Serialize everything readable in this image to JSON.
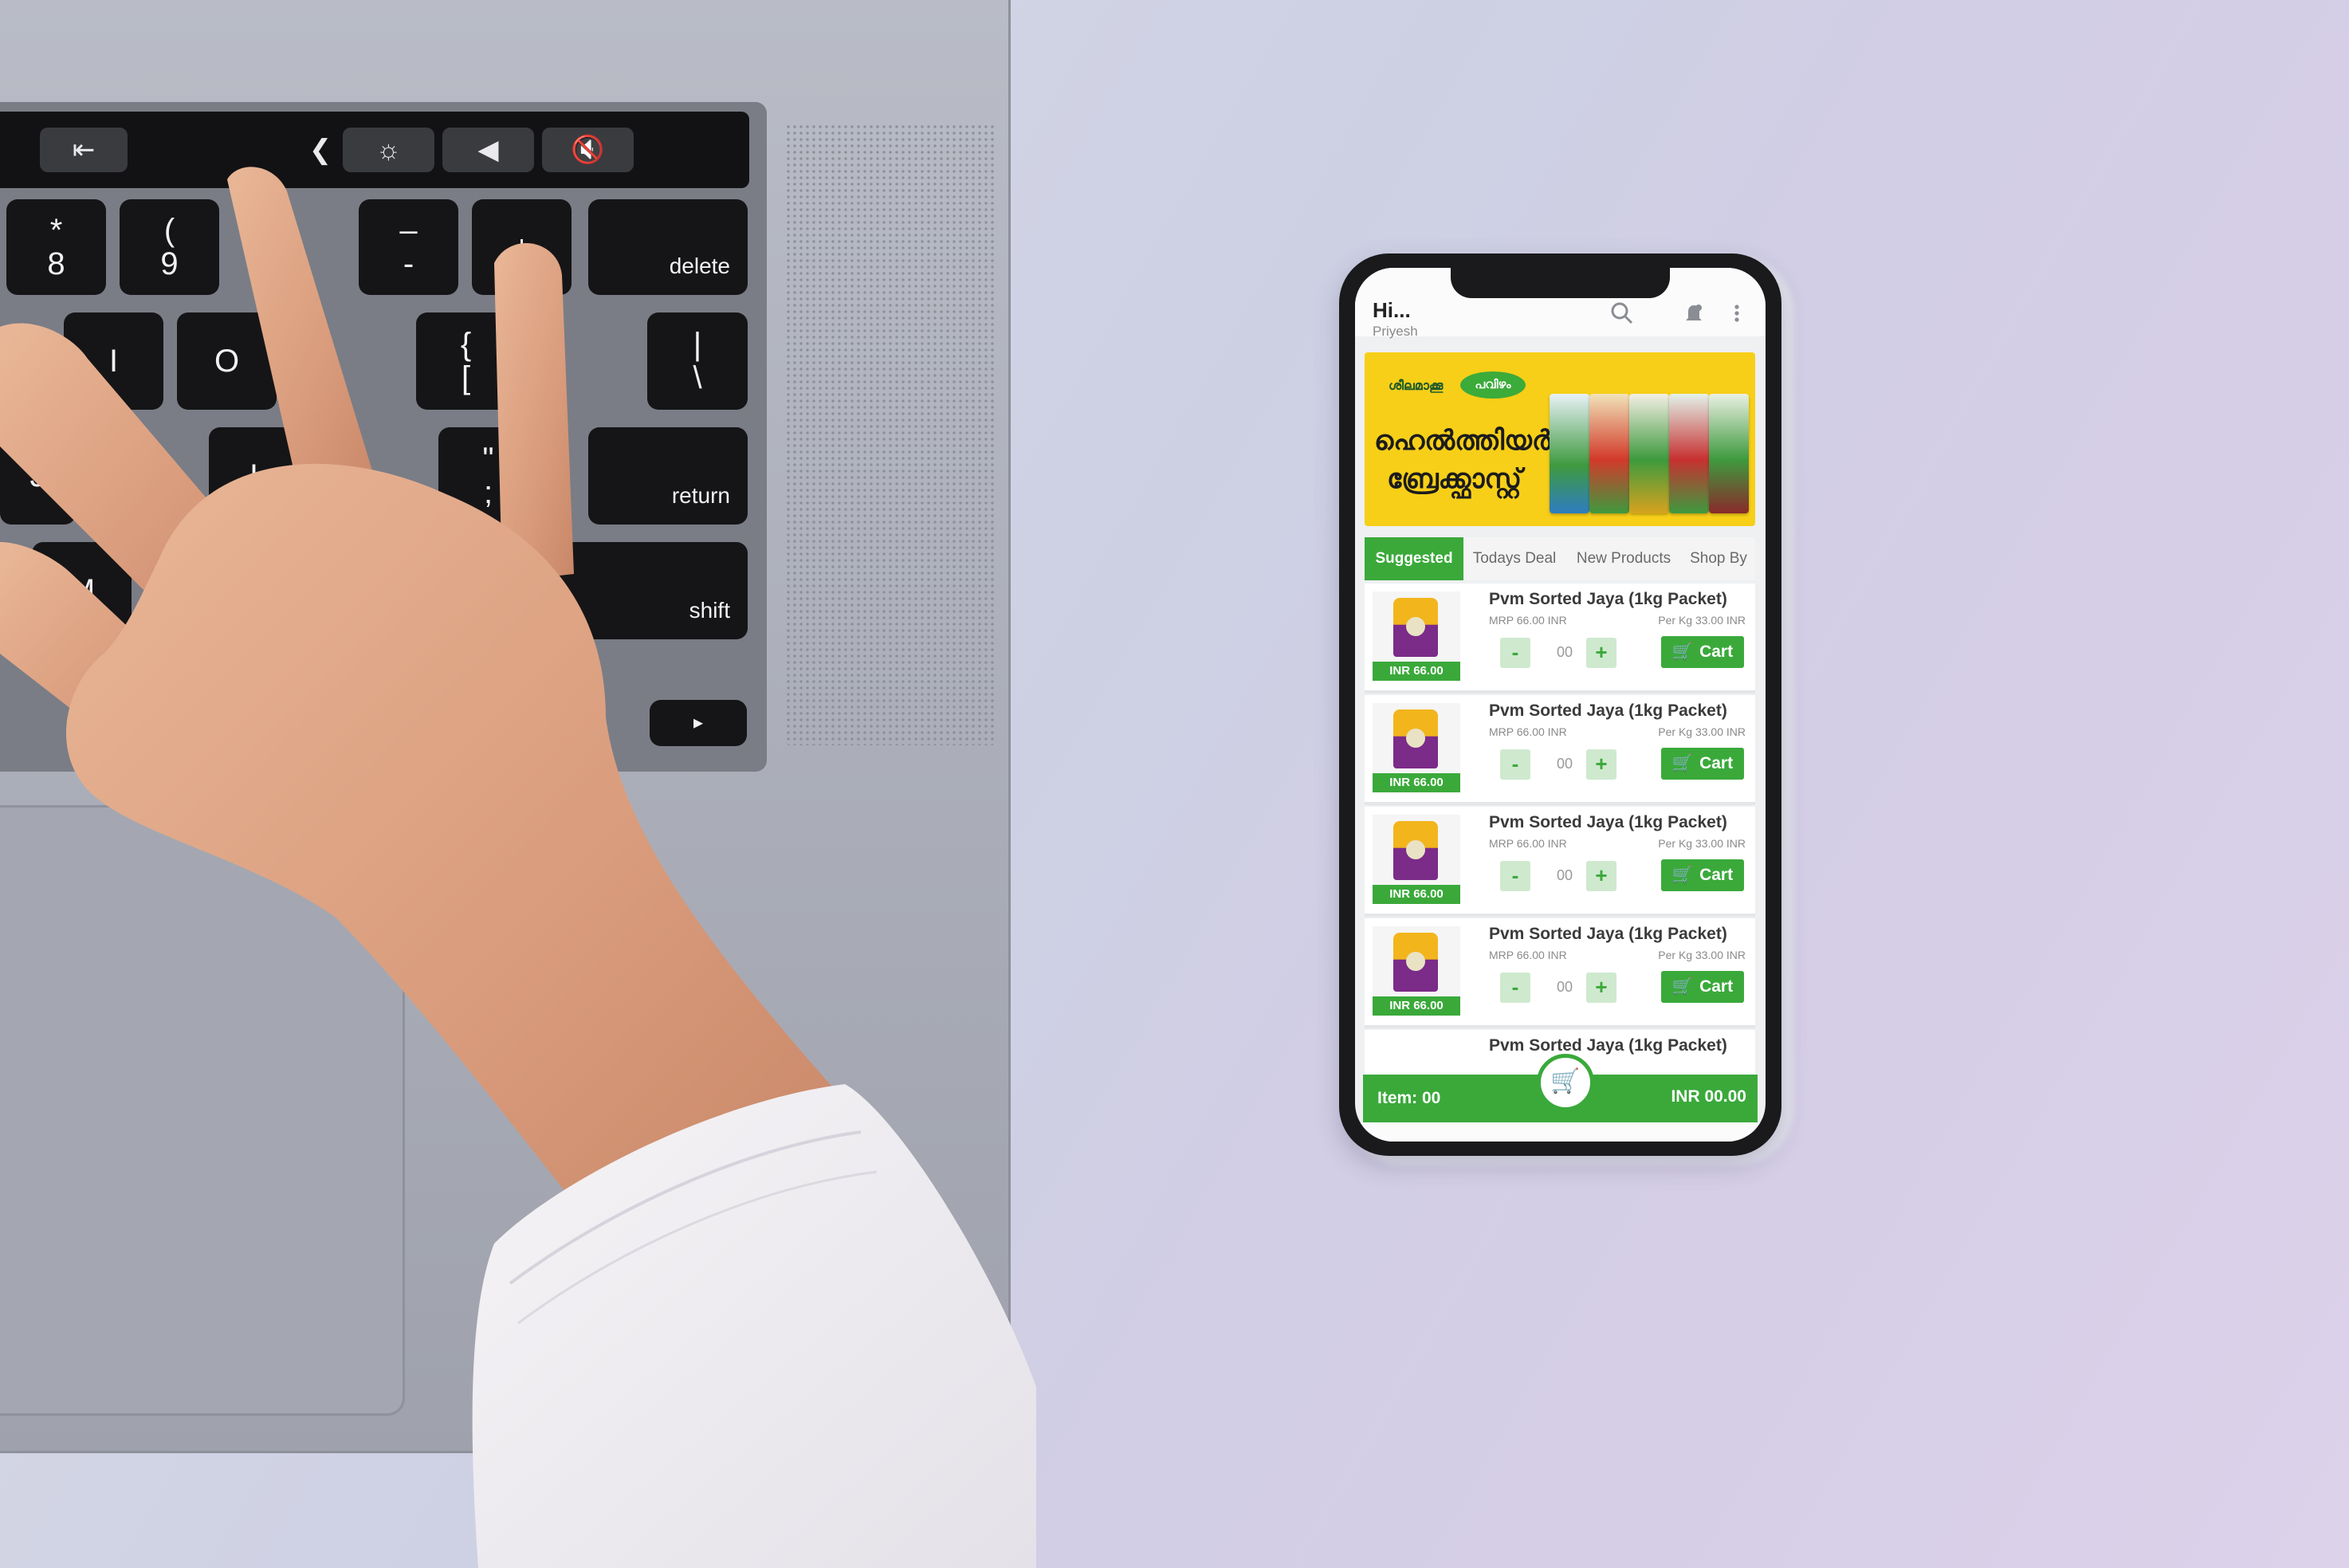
{
  "touchbar": {
    "items": [
      "⇤",
      "❮",
      "☼",
      "◀",
      "🔇"
    ]
  },
  "keyboard": {
    "keys": [
      {
        "top": "*",
        "bottom": "8"
      },
      {
        "top": "(",
        "bottom": "9"
      },
      {
        "top": "–",
        "bottom": "-"
      },
      {
        "top": "+",
        "bottom": ""
      },
      {
        "top": "",
        "bottom": "delete"
      },
      {
        "top": "",
        "bottom": "I"
      },
      {
        "top": "",
        "bottom": "O"
      },
      {
        "top": "{",
        "bottom": "["
      },
      {
        "top": "|",
        "bottom": "\\"
      },
      {
        "top": "",
        "bottom": "J"
      },
      {
        "top": "",
        "bottom": "L"
      },
      {
        "top": "\"",
        "bottom": ";"
      },
      {
        "top": "",
        "bottom": "return"
      },
      {
        "top": "",
        "bottom": "M"
      },
      {
        "top": "",
        "bottom": ">"
      },
      {
        "top": "",
        "bottom": "shift"
      },
      {
        "top": "",
        "bottom": "⌘"
      },
      {
        "top": "",
        "bottom": "▸"
      }
    ]
  },
  "app": {
    "greeting": "Hi...",
    "user_name": "Priyesh",
    "icons": {
      "search": "search-icon",
      "notify": "notification-icon",
      "menu": "more-vertical-icon"
    },
    "banner": {
      "brand_prefix": "ശീലമാക്കൂ",
      "brand": "പവിഴം",
      "line1": "ഹെൽത്തിയർ",
      "line2": "ബ്രേക്ക്ഫാസ്റ്റ്"
    },
    "tabs": [
      {
        "label": "Suggested",
        "active": true
      },
      {
        "label": "Todays Deal",
        "active": false
      },
      {
        "label": "New Products",
        "active": false
      },
      {
        "label": "Shop By",
        "active": false
      }
    ],
    "products": [
      {
        "name": "Pvm Sorted Jaya (1kg Packet)",
        "mrp": "MRP 66.00 INR",
        "per_kg": "Per Kg 33.00 INR",
        "price": "INR 66.00",
        "qty": "00",
        "cart_label": "Cart"
      },
      {
        "name": "Pvm Sorted Jaya (1kg Packet)",
        "mrp": "MRP 66.00 INR",
        "per_kg": "Per Kg 33.00 INR",
        "price": "INR 66.00",
        "qty": "00",
        "cart_label": "Cart"
      },
      {
        "name": "Pvm Sorted Jaya (1kg Packet)",
        "mrp": "MRP 66.00 INR",
        "per_kg": "Per Kg 33.00 INR",
        "price": "INR 66.00",
        "qty": "00",
        "cart_label": "Cart"
      },
      {
        "name": "Pvm Sorted Jaya (1kg Packet)",
        "mrp": "MRP 66.00 INR",
        "per_kg": "Per Kg 33.00 INR",
        "price": "INR 66.00",
        "qty": "00",
        "cart_label": "Cart"
      },
      {
        "name": "Pvm Sorted Jaya (1kg Packet)"
      }
    ],
    "footer": {
      "items": "Item: 00",
      "total": "INR 00.00"
    },
    "colors": {
      "accent": "#3aa93a",
      "banner": "#f7cf18"
    }
  }
}
